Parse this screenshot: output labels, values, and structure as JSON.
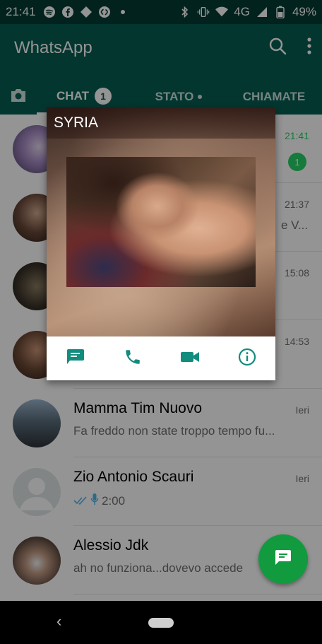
{
  "status_bar": {
    "time": "21:41",
    "network": "4G",
    "battery": "49%"
  },
  "app": {
    "title": "WhatsApp",
    "accent": "#075e54",
    "tabs": [
      {
        "label": "CHAT",
        "badge": "1"
      },
      {
        "label": "STATO"
      },
      {
        "label": "CHIAMATE"
      }
    ]
  },
  "chats": [
    {
      "name": "",
      "message": "",
      "time": "21:41",
      "unread": "1"
    },
    {
      "name": "",
      "message": "e V...",
      "time": "21:37"
    },
    {
      "name": "",
      "message": "",
      "time": "15:08"
    },
    {
      "name": "",
      "message": "",
      "time": "14:53"
    },
    {
      "name": "Mamma Tim Nuovo",
      "message": "Fa freddo non state troppo tempo fu...",
      "time": "Ieri"
    },
    {
      "name": "Zio Antonio Scauri",
      "message": "2:00",
      "time": "Ieri"
    },
    {
      "name": "Alessio Jdk",
      "message": "ah no funziona...dovevo accede",
      "time": ""
    }
  ],
  "popup": {
    "contact_name": "SYRIA",
    "actions": [
      "message-icon",
      "phone-icon",
      "video-call-icon",
      "info-icon"
    ]
  }
}
